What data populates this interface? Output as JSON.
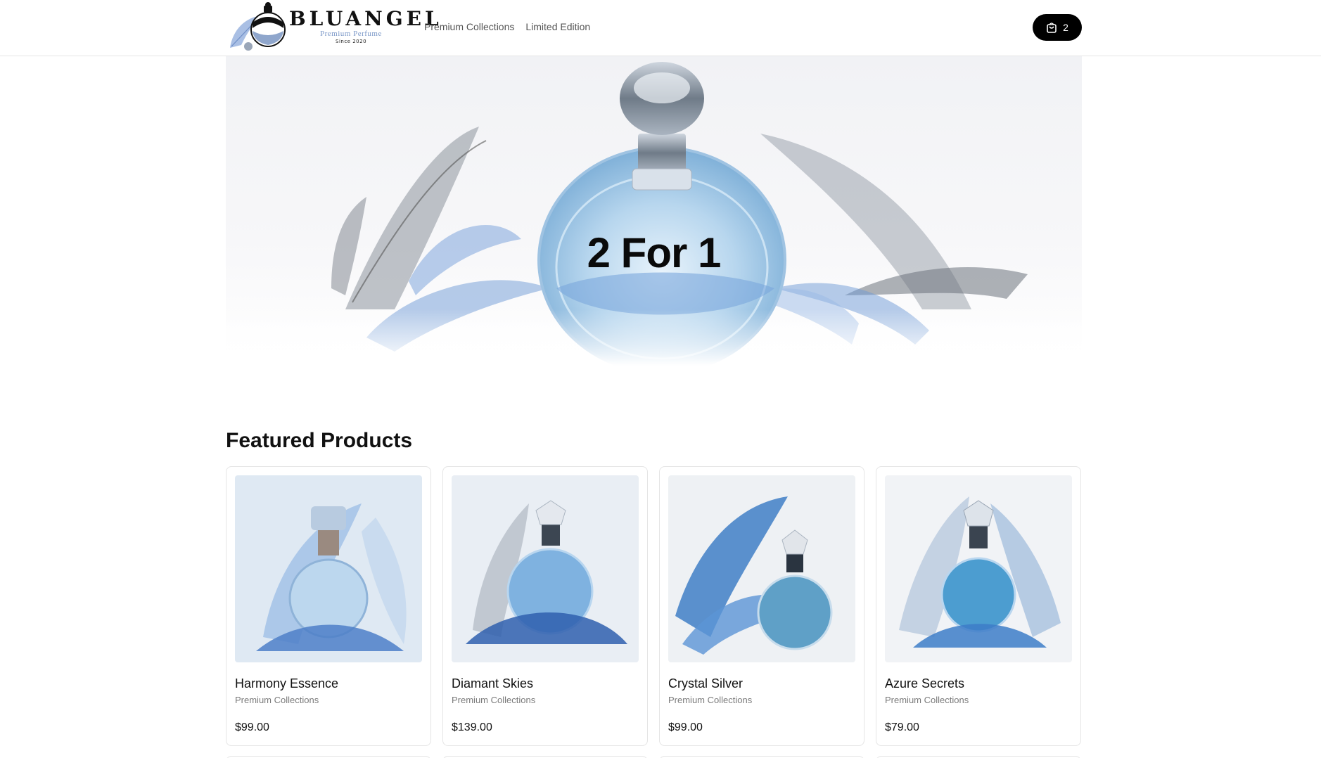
{
  "header": {
    "brand_name": "BLUANGEL",
    "brand_tagline": "Premium Perfume",
    "brand_since": "Since 2020",
    "nav": [
      {
        "label": "Premium Collections"
      },
      {
        "label": "Limited Edition"
      }
    ],
    "cart_count": "2",
    "cart_icon": "shopping-bag-icon"
  },
  "hero": {
    "title": "2 For 1"
  },
  "featured": {
    "title": "Featured Products",
    "products": [
      {
        "name": "Harmony Essence",
        "category": "Premium Collections",
        "price": "$99.00"
      },
      {
        "name": "Diamant Skies",
        "category": "Premium Collections",
        "price": "$139.00"
      },
      {
        "name": "Crystal Silver",
        "category": "Premium Collections",
        "price": "$99.00"
      },
      {
        "name": "Azure Secrets",
        "category": "Premium Collections",
        "price": "$79.00"
      }
    ]
  },
  "colors": {
    "accent": "#000000",
    "perfume_blue": "#5d8fd0",
    "muted_text": "#7a7a7a"
  }
}
